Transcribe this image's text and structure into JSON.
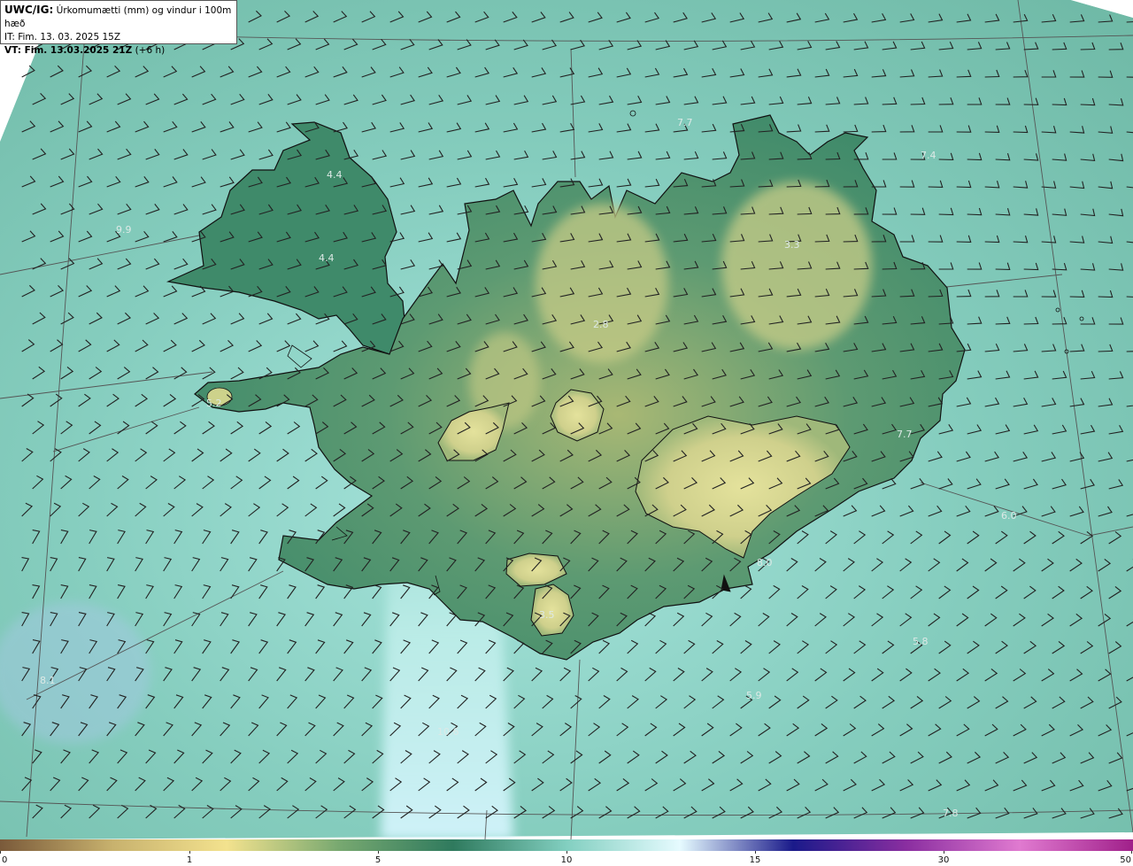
{
  "info": {
    "model": "UWC/IG:",
    "title": "Úrkomumætti (mm) og vindur i 100m hæð",
    "issue_time": "IT: Fim. 13. 03. 2025 15Z",
    "valid_label": "VT: Fim. 13.03.2025 21Z",
    "valid_offset": "(+6 h)"
  },
  "colors": {
    "sea_fill": "#78c4b4",
    "sea_light": "#a9e6e0",
    "land_dark": "#3e8a6a",
    "land_mid": "#5a9c74",
    "land_high": "#c9cf8c",
    "glacier": "#dcdc9a",
    "coastline": "#111111",
    "barb": "#222222",
    "gridline": "#555555"
  },
  "value_labels": [
    {
      "text": "4.4"
    },
    {
      "text": "4.4"
    },
    {
      "text": "9.9"
    },
    {
      "text": "7.7"
    },
    {
      "text": "7.4"
    },
    {
      "text": "3.3"
    },
    {
      "text": "2.8"
    },
    {
      "text": "5.2"
    },
    {
      "text": "6.0"
    },
    {
      "text": "8.0"
    },
    {
      "text": "3.5"
    },
    {
      "text": "5.8"
    },
    {
      "text": "5.9"
    },
    {
      "text": "10.6"
    },
    {
      "text": "7.8"
    },
    {
      "text": "8.1"
    },
    {
      "text": "7.7"
    }
  ],
  "colorbar": {
    "stops": [
      "#7a5a3a",
      "#c8b26e",
      "#f3e28e",
      "#77a870",
      "#2f7a5e",
      "#82cfc0",
      "#e6fbff",
      "#1a1a8a",
      "#8a2ea0",
      "#e07ad0",
      "#a0208a"
    ],
    "ticks": [
      {
        "label": "0",
        "value": 0
      },
      {
        "label": "1",
        "value": 1
      },
      {
        "label": "5",
        "value": 5
      },
      {
        "label": "10",
        "value": 10
      },
      {
        "label": "15",
        "value": 15
      },
      {
        "label": "30",
        "value": 30
      },
      {
        "label": "50",
        "value": 50
      }
    ]
  }
}
